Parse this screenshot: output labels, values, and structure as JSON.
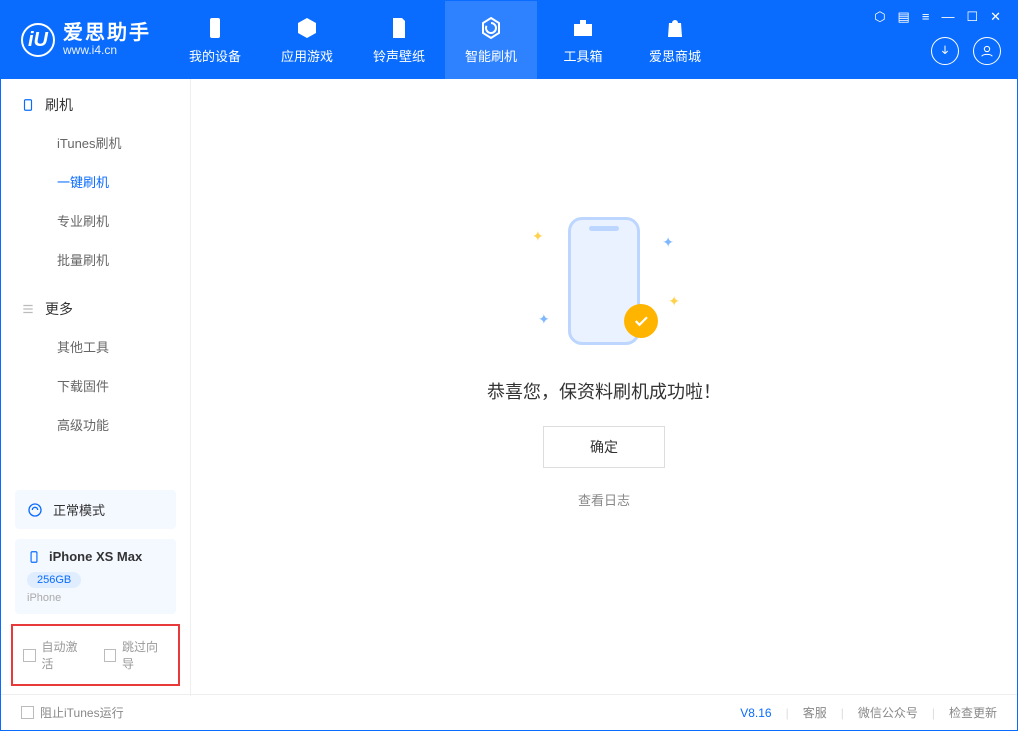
{
  "app": {
    "name": "爱思助手",
    "url": "www.i4.cn"
  },
  "nav": {
    "items": [
      {
        "label": "我的设备"
      },
      {
        "label": "应用游戏"
      },
      {
        "label": "铃声壁纸"
      },
      {
        "label": "智能刷机"
      },
      {
        "label": "工具箱"
      },
      {
        "label": "爱思商城"
      }
    ]
  },
  "sidebar": {
    "section1": {
      "title": "刷机",
      "items": [
        "iTunes刷机",
        "一键刷机",
        "专业刷机",
        "批量刷机"
      ]
    },
    "section2": {
      "title": "更多",
      "items": [
        "其他工具",
        "下载固件",
        "高级功能"
      ]
    },
    "mode": "正常模式",
    "device": {
      "name": "iPhone XS Max",
      "capacity": "256GB",
      "type": "iPhone"
    },
    "checks": {
      "auto_activate": "自动激活",
      "skip_guide": "跳过向导"
    }
  },
  "main": {
    "success": "恭喜您，保资料刷机成功啦！",
    "ok": "确定",
    "view_log": "查看日志"
  },
  "footer": {
    "block_itunes": "阻止iTunes运行",
    "version": "V8.16",
    "support": "客服",
    "wechat": "微信公众号",
    "update": "检查更新"
  }
}
